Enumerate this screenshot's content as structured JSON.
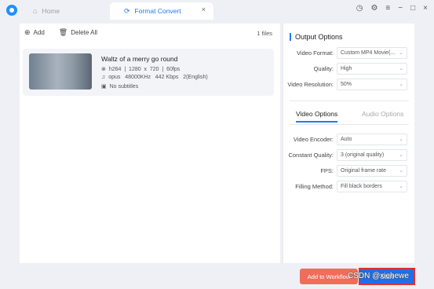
{
  "tabs": {
    "home_label": "Home",
    "home_icon": "home-icon",
    "convert_label": "Format Convert",
    "convert_icon": "refresh-icon",
    "close_glyph": "×"
  },
  "window_controls": {
    "clock_icon": "clock-icon",
    "settings_icon": "gear-icon",
    "menu_glyph": "≡",
    "minimize_glyph": "−",
    "maximize_glyph": "□",
    "close_glyph": "×"
  },
  "toolbar": {
    "add_label": "Add",
    "delete_all_label": "Delete All",
    "files_count": "1 files"
  },
  "file": {
    "name": "Waltz of a merry go round",
    "video_info": "h264  |  1280  x  720  |  60fps",
    "audio_info": "opus   48000KHz   442 Kbps   2(English)",
    "subtitle_info": "No subtitles"
  },
  "output_options": {
    "title": "Output Options",
    "fields": [
      {
        "label": "Video Format:",
        "value": "Custom MP4 Movie(..."
      },
      {
        "label": "Quality:",
        "value": "High"
      },
      {
        "label": "Video Resolution:",
        "value": "50%"
      }
    ]
  },
  "subtabs": {
    "video": "Video Options",
    "audio": "Audio Options"
  },
  "video_options": [
    {
      "label": "Video Encoder:",
      "value": "Auto"
    },
    {
      "label": "Constant Quality:",
      "value": "3 (original quality)"
    },
    {
      "label": "FPS:",
      "value": "Original frame rate"
    },
    {
      "label": "Filling Method:",
      "value": "Fill black borders"
    }
  ],
  "footer": {
    "add_workflow_label": "Add to Workflow",
    "start_label": "Start"
  },
  "watermark": "CSDN @xiehewe",
  "colors": {
    "accent": "#1f7bf2",
    "add_workflow": "#f06d5c",
    "start_border": "#e03030"
  }
}
